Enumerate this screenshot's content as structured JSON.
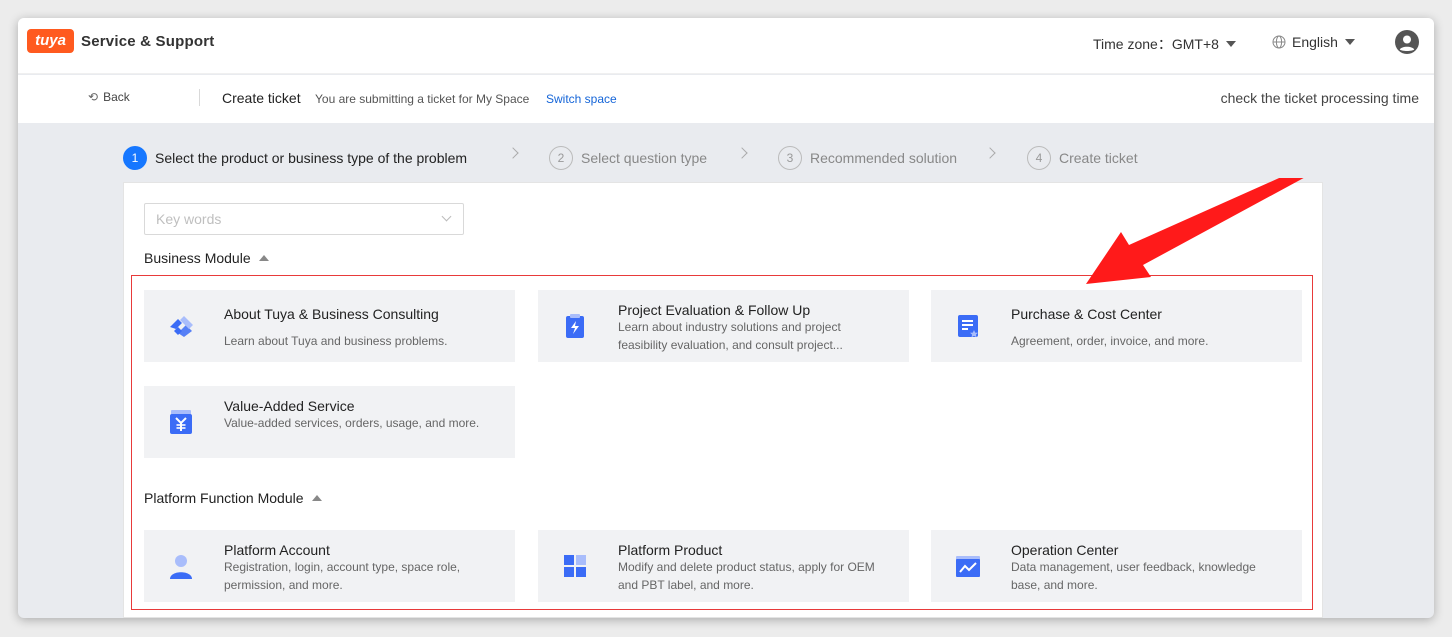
{
  "header": {
    "logo_badge": "tuya",
    "logo_text": "Service & Support",
    "timezone_label": "Time zone：GMT+8",
    "language": "English"
  },
  "subbar": {
    "back_label": "Back",
    "title": "Create ticket",
    "hint": "You are submitting a ticket for My Space",
    "switch_space": "Switch space",
    "check_time": "check the ticket processing time"
  },
  "steps": [
    {
      "num": "1",
      "label": "Select the product or business type of the problem"
    },
    {
      "num": "2",
      "label": "Select question type"
    },
    {
      "num": "3",
      "label": "Recommended solution"
    },
    {
      "num": "4",
      "label": "Create ticket"
    }
  ],
  "search": {
    "placeholder": "Key words"
  },
  "sections": {
    "business": "Business Module",
    "platform": "Platform Function Module"
  },
  "cards": [
    {
      "title": "About Tuya & Business Consulting",
      "desc": "Learn about Tuya and business problems.",
      "icon": "handshake-icon"
    },
    {
      "title": "Project Evaluation & Follow Up",
      "desc": "Learn about industry solutions and project feasibility evaluation, and consult project...",
      "icon": "clipboard-bolt-icon"
    },
    {
      "title": "Purchase & Cost Center",
      "desc": "Agreement, order, invoice, and more.",
      "icon": "document-star-icon"
    },
    {
      "title": "Value-Added Service",
      "desc": "Value-added services, orders, usage, and more.",
      "icon": "yen-icon"
    },
    {
      "title": "Platform Account",
      "desc": "Registration, login, account type, space role, permission, and more.",
      "icon": "user-icon"
    },
    {
      "title": "Platform Product",
      "desc": "Modify and delete product status, apply for OEM and PBT label, and more.",
      "icon": "blocks-icon"
    },
    {
      "title": "Operation Center",
      "desc": "Data management, user feedback, knowledge base, and more.",
      "icon": "chart-window-icon"
    }
  ],
  "colors": {
    "accent": "#1677ff",
    "icon_blue": "#3b6cf6",
    "brand": "#ff5a1f",
    "highlight": "#e83a3a"
  }
}
